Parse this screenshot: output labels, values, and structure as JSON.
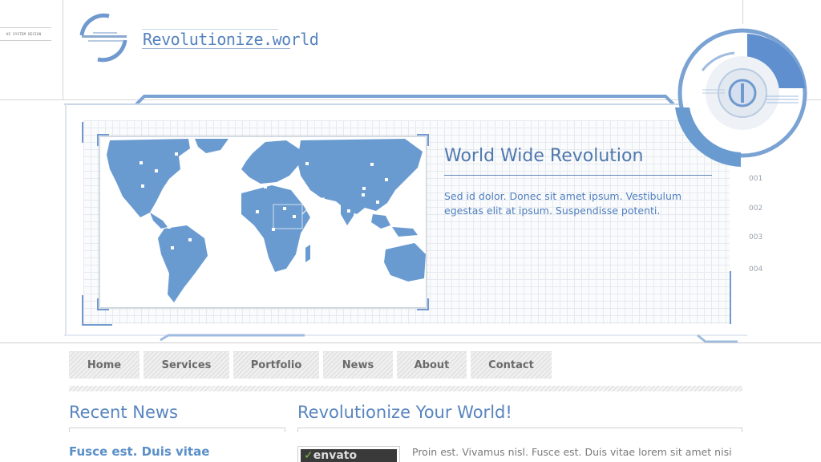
{
  "header": {
    "corner_text": "HI SYSTEM DESIGN",
    "logo_text": "Revolutionize.world"
  },
  "hero": {
    "title": "World Wide Revolution",
    "text": "Sed id dolor. Donec sit amet ipsum. Vestibulum egestas elit at ipsum. Suspendisse potenti.",
    "side_numbers": [
      "001",
      "002",
      "003",
      "004"
    ]
  },
  "nav": {
    "items": [
      {
        "label": "Home"
      },
      {
        "label": "Services"
      },
      {
        "label": "Portfolio"
      },
      {
        "label": "News"
      },
      {
        "label": "About"
      },
      {
        "label": "Contact"
      }
    ]
  },
  "content": {
    "recent_news_title": "Recent News",
    "news_item_heading": "Fusce est. Duis vitae",
    "main_title": "Revolutionize Your World!",
    "thumb_text": "envato",
    "body_text": "Proin est. Vivamus nisl. Fusce est. Duis vitae lorem sit amet nisi"
  },
  "colors": {
    "accent": "#5885bf",
    "map_blue": "#6a9bd0",
    "frame_blue": "#7aa3d4"
  }
}
